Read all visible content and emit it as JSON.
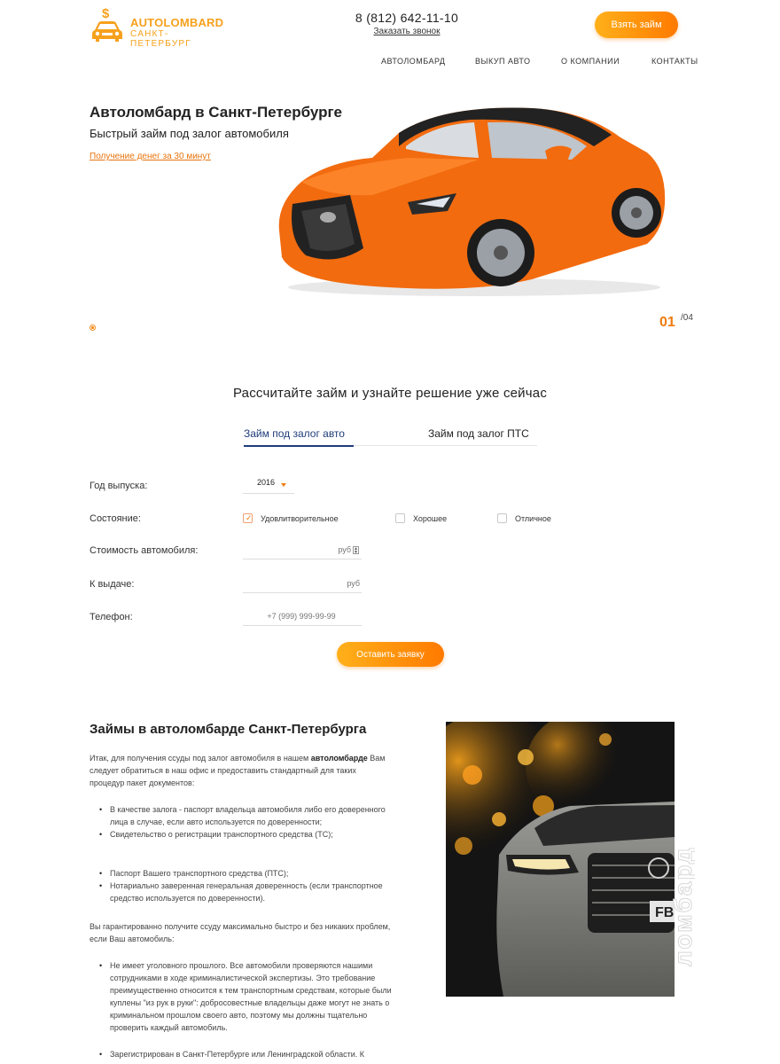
{
  "header": {
    "logo": {
      "title": "AUTOLOMBARD",
      "subtitle": "САНКТ-ПЕТЕРБУРГ"
    },
    "phone": "8 (812) 642-11-10",
    "callback_link": "Заказать звонок",
    "cta_button": "Взять займ",
    "nav": [
      "АВТОЛОМБАРД",
      "ВЫКУП АВТО",
      "О КОМПАНИИ",
      "КОНТАКТЫ"
    ]
  },
  "hero": {
    "title": "Автоломбард в Санкт-Петербурге",
    "subtitle": "Быстрый займ под залог автомобиля",
    "link": "Получение денег за 30 минут",
    "slide_current": "01",
    "slide_total": "/04"
  },
  "calculator": {
    "title": "Рассчитайте займ и узнайте решение уже сейчас",
    "tabs": [
      {
        "label": "Займ под залог авто",
        "active": true
      },
      {
        "label": "Займ под залог ПТС",
        "active": false
      }
    ],
    "labels": {
      "year": "Год выпуска:",
      "condition": "Состояние:",
      "car_value": "Стоимость автомобиля:",
      "payout": "К выдаче:",
      "phone": "Телефон:"
    },
    "year_value": "2016",
    "conditions": [
      {
        "label": "Удовлитворительное",
        "checked": true
      },
      {
        "label": "Хорошее",
        "checked": false
      },
      {
        "label": "Отличное",
        "checked": false
      }
    ],
    "car_value_placeholder": "руб",
    "payout_placeholder": "руб",
    "phone_placeholder": "+7 (999) 999-99-99",
    "submit_button": "Оставить заявку"
  },
  "article": {
    "title": "Займы в автоломбарде Санкт-Петербурга",
    "intro_before": "Итак, для получения ссуды под залог автомобиля в нашем ",
    "intro_bold": "автоломбарде",
    "intro_after": " Вам следует обратиться в наш офис и предоставить стандартный для таких процедур пакет документов:",
    "list1": [
      "В качестве залога - паспорт владельца автомобиля либо его доверенного лица в случае, если авто используется по доверенности;",
      "Свидетельство о регистрации транспортного средства (ТС);"
    ],
    "list2": [
      "Паспорт Вашего транспортного средства (ПТС);",
      "Нотариально заверенная генеральная доверенность (если транспортное средство используется по доверенности)."
    ],
    "paragraph2": "Вы гарантированно получите ссуду максимально быстро и без никаких проблем, если Ваш автомобиль:",
    "list3": [
      "Не имеет уголовного прошлого. Все автомобили проверяются нашими сотрудниками в ходе криминалистической экспертизы. Это требование преимущественно относится к тем транспортным средствам, которые были куплены \"из рук в руки\": добросовестные владельцы даже могут не знать о криминальном прошлом своего авто, поэтому мы должны тщательно проверить каждый автомобиль.",
      "Зарегистрирован в Санкт-Петербурге или Ленинградской области. К"
    ],
    "side_vertical_text": "ломбард",
    "plate_text": "FB"
  },
  "colors": {
    "accent": "#ef7b0c",
    "button_from": "#ffb01a",
    "button_to": "#ff7a00",
    "tab_active": "#1f3d7a"
  }
}
